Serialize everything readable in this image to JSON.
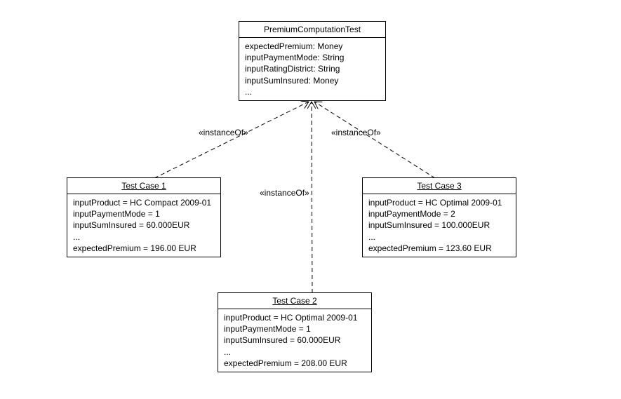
{
  "classBox": {
    "title": "PremiumComputationTest",
    "attrs": [
      "expectedPremium: Money",
      "inputPaymentMode: String",
      "inputRatingDistrict: String",
      "inputSumInsured: Money",
      "..."
    ]
  },
  "labels": {
    "instanceOf1": "«instanceOf»",
    "instanceOf2": "«instanceOf»",
    "instanceOf3": "«instanceOf»"
  },
  "testCase1": {
    "title": "Test Case 1",
    "lines": [
      "inputProduct = HC Compact 2009-01",
      "inputPaymentMode = 1",
      "inputSumInsured = 60.000EUR",
      "...",
      "expectedPremium = 196.00 EUR"
    ]
  },
  "testCase2": {
    "title": "Test Case 2",
    "lines": [
      "inputProduct = HC Optimal 2009-01",
      "inputPaymentMode = 1",
      "inputSumInsured = 60.000EUR",
      "...",
      "expectedPremium = 208.00 EUR"
    ]
  },
  "testCase3": {
    "title": "Test Case 3",
    "lines": [
      "inputProduct = HC Optimal 2009-01",
      "inputPaymentMode = 2",
      "inputSumInsured = 100.000EUR",
      "...",
      "expectedPremium = 123.60 EUR"
    ]
  }
}
